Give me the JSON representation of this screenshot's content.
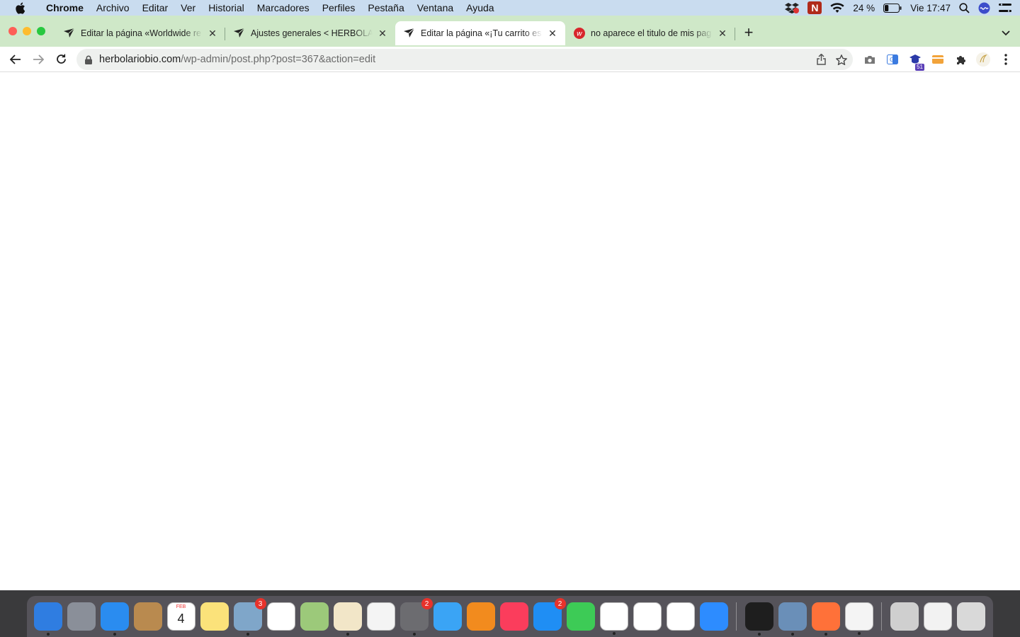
{
  "menubar": {
    "apple_icon": "apple-logo-icon",
    "app_name": "Chrome",
    "items": [
      "Archivo",
      "Editar",
      "Ver",
      "Historial",
      "Marcadores",
      "Perfiles",
      "Pestaña",
      "Ventana",
      "Ayuda"
    ],
    "battery": "24 %",
    "clock": "Vie 17:47"
  },
  "browser": {
    "tabs": [
      {
        "title": "Editar la página «Worldwide re",
        "favicon": "wordpress-plane-icon",
        "active": false
      },
      {
        "title": "Ajustes generales < HERBOLARIO",
        "favicon": "wordpress-plane-icon",
        "active": false
      },
      {
        "title": "Editar la página «¡Tu carrito es",
        "favicon": "wordpress-plane-icon",
        "active": true
      },
      {
        "title": "no aparece el titulo de mis pag",
        "favicon": "red-w-icon",
        "active": false
      }
    ],
    "new_tab_label": "+",
    "url_host": "herbolariobio.com",
    "url_path": "/wp-admin/post.php?post=367&action=edit",
    "extension_badge": "51"
  },
  "dock": {
    "apps": [
      {
        "name": "finder",
        "color": "#2f7de1",
        "running": true
      },
      {
        "name": "launchpad",
        "color": "#8a8f99",
        "running": false
      },
      {
        "name": "safari",
        "color": "#2a8cf0",
        "running": true
      },
      {
        "name": "contacts",
        "color": "#b98a4f",
        "running": false
      },
      {
        "name": "calendar",
        "color": "#ffffff",
        "running": false,
        "text": "4",
        "month": "FEB"
      },
      {
        "name": "notes",
        "color": "#fbe27a",
        "running": false
      },
      {
        "name": "mail-preview",
        "color": "#7fa6c9",
        "running": true,
        "badge": "3"
      },
      {
        "name": "reminders",
        "color": "#ffffff",
        "running": false
      },
      {
        "name": "maps",
        "color": "#9cc97a",
        "running": false
      },
      {
        "name": "textedit",
        "color": "#f2e6c8",
        "running": true
      },
      {
        "name": "photos",
        "color": "#f4f4f4",
        "running": false
      },
      {
        "name": "system-preferences",
        "color": "#6c6c70",
        "running": true,
        "badge": "2"
      },
      {
        "name": "messages",
        "color": "#3aa4f5",
        "running": false
      },
      {
        "name": "books",
        "color": "#f28b1e",
        "running": false
      },
      {
        "name": "music",
        "color": "#fb3d5c",
        "running": false
      },
      {
        "name": "app-store",
        "color": "#1f8ef4",
        "running": false,
        "badge": "2"
      },
      {
        "name": "facetime",
        "color": "#3dcb56",
        "running": false
      },
      {
        "name": "chrome",
        "color": "#ffffff",
        "running": true
      },
      {
        "name": "numbers",
        "color": "#ffffff",
        "running": false
      },
      {
        "name": "keynote",
        "color": "#ffffff",
        "running": false
      },
      {
        "name": "zoom",
        "color": "#2d8cff",
        "running": false
      }
    ],
    "apps_right": [
      {
        "name": "terminal",
        "color": "#1e1e1e",
        "running": true
      },
      {
        "name": "preview",
        "color": "#6a8fb8",
        "running": true
      },
      {
        "name": "firefox",
        "color": "#ff7139",
        "running": true
      },
      {
        "name": "java",
        "color": "#f4f4f4",
        "running": true
      }
    ],
    "stack_items": [
      {
        "name": "downloads-stack",
        "color": "#cfcfcf"
      },
      {
        "name": "documents-stack",
        "color": "#f2f2f2"
      },
      {
        "name": "trash",
        "color": "#d9d9d9"
      }
    ]
  }
}
